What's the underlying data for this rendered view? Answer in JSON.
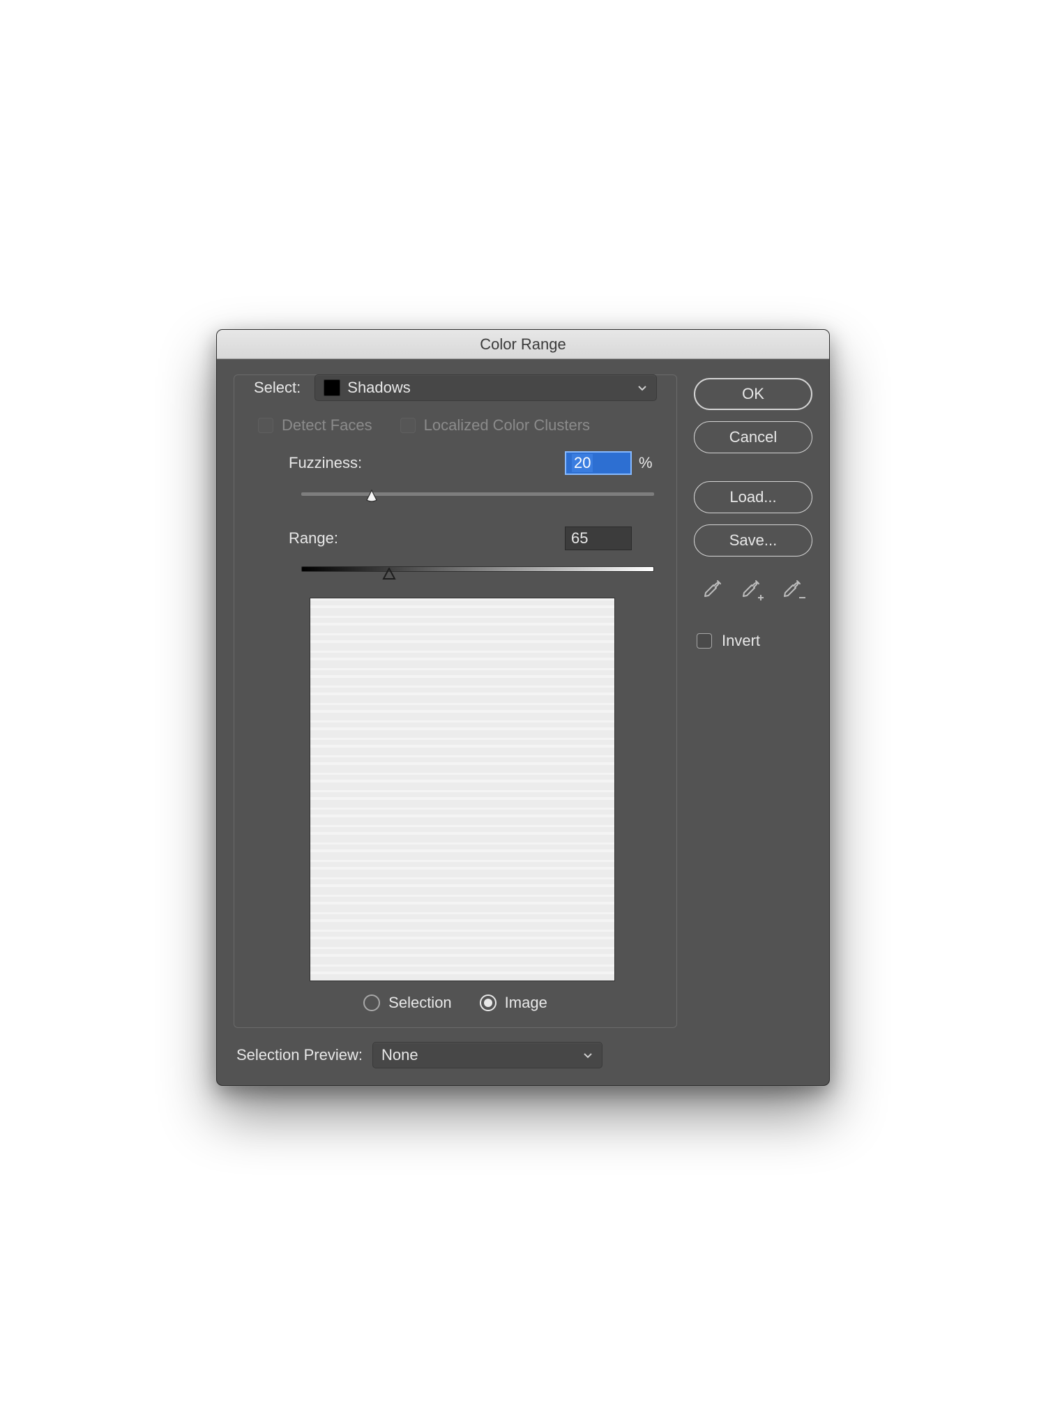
{
  "title": "Color Range",
  "labels": {
    "select": "Select:",
    "detect_faces": "Detect Faces",
    "localized_clusters": "Localized Color Clusters",
    "fuzziness": "Fuzziness:",
    "range": "Range:",
    "percent": "%",
    "selection": "Selection",
    "image": "Image",
    "selection_preview": "Selection Preview:",
    "invert": "Invert"
  },
  "select": {
    "value": "Shadows"
  },
  "values": {
    "fuzziness": "20",
    "range": "65"
  },
  "checkboxes": {
    "detect_faces": false,
    "detect_faces_enabled": false,
    "localized_clusters": false,
    "localized_clusters_enabled": false,
    "invert": false
  },
  "radio": {
    "mode": "Image"
  },
  "selection_preview": {
    "value": "None"
  },
  "buttons": {
    "ok": "OK",
    "cancel": "Cancel",
    "load": "Load...",
    "save": "Save..."
  },
  "colors": {
    "panel": "#535353",
    "text": "#e8e8e8",
    "dim_text": "#8b8b8b",
    "input_bg": "#3c3c3c",
    "highlight": "#2d6fd2"
  }
}
